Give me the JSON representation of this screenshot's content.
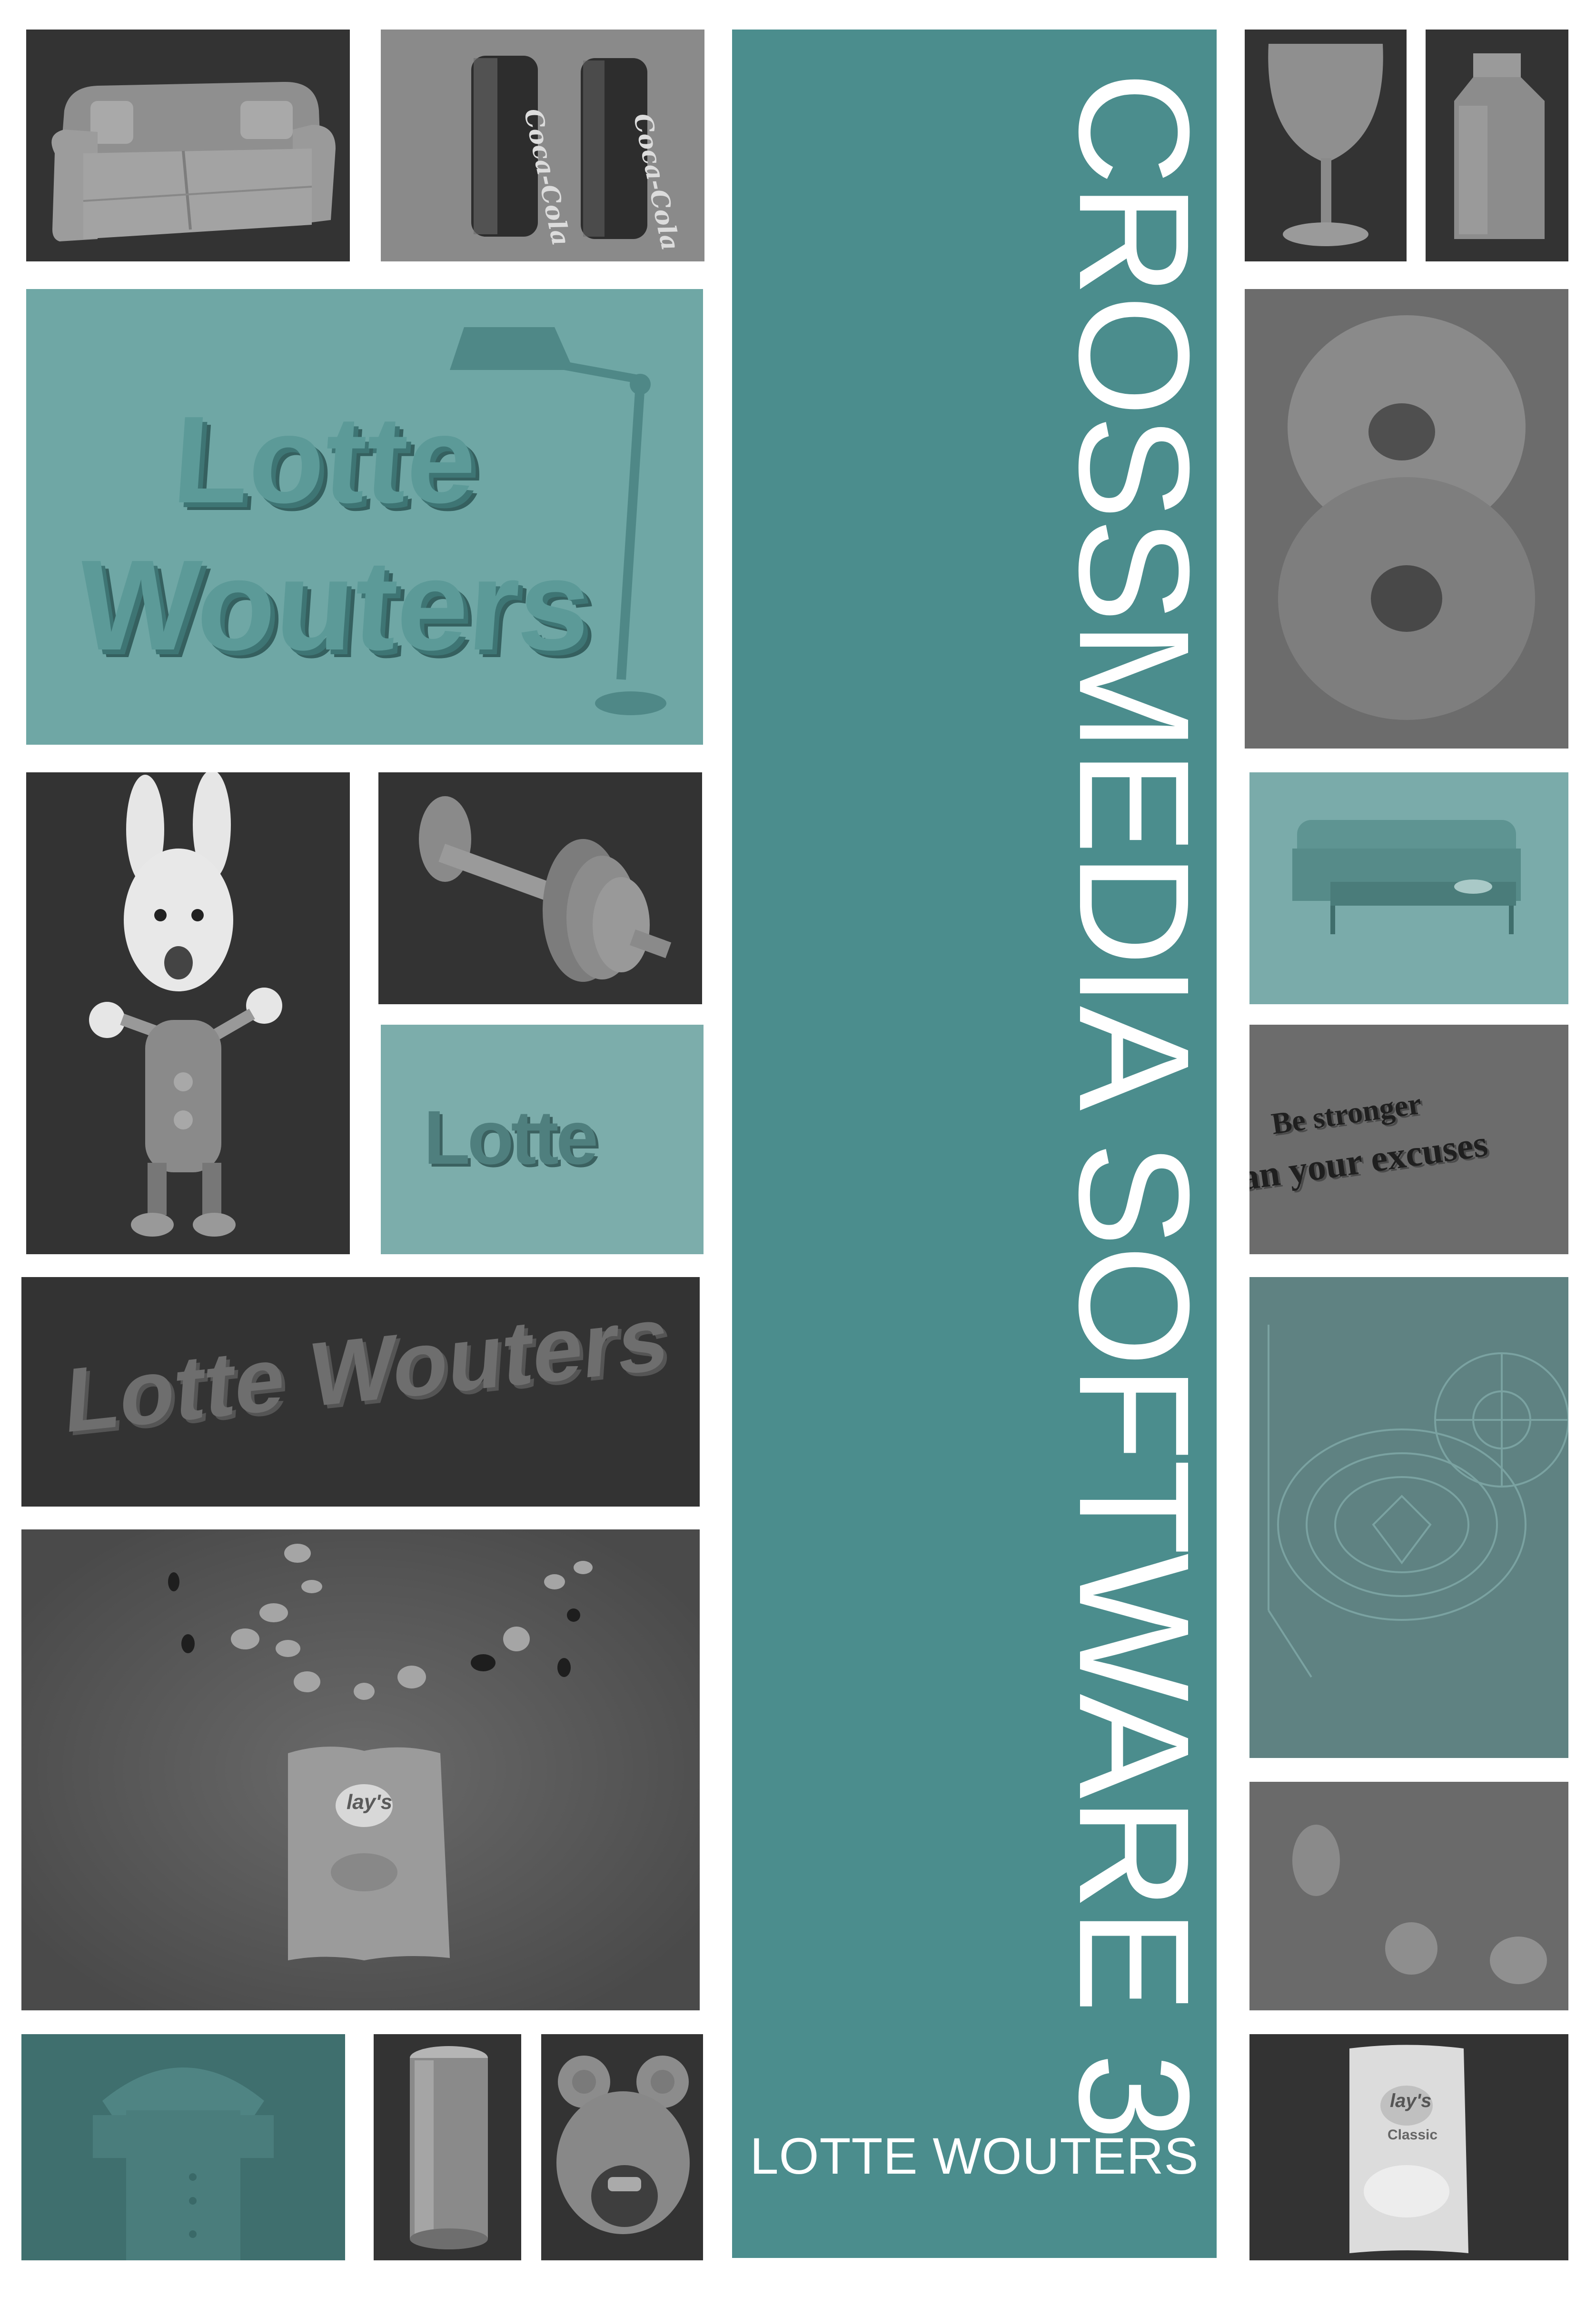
{
  "cover": {
    "title": "CROSSMEDIA  SOFTWARE 3",
    "author": "LOTTE WOUTERS"
  },
  "tiles": {
    "cola_brand": "Coca-Cola",
    "lotte_wouters_top": "Lotte",
    "lotte_wouters_bottom": "Wouters",
    "lotte": "Lotte",
    "lotte_wouters_banner": "Lotte Wouters",
    "lays_brand": "lay's",
    "lays_variant": "Classic",
    "motivation_line1": "Be stronger",
    "motivation_line2": "than your excuses"
  },
  "colors": {
    "spine": "#4b8d8d",
    "teal_tile": "#6fa7a5",
    "dark_tile": "#333333",
    "text": "#ffffff"
  }
}
